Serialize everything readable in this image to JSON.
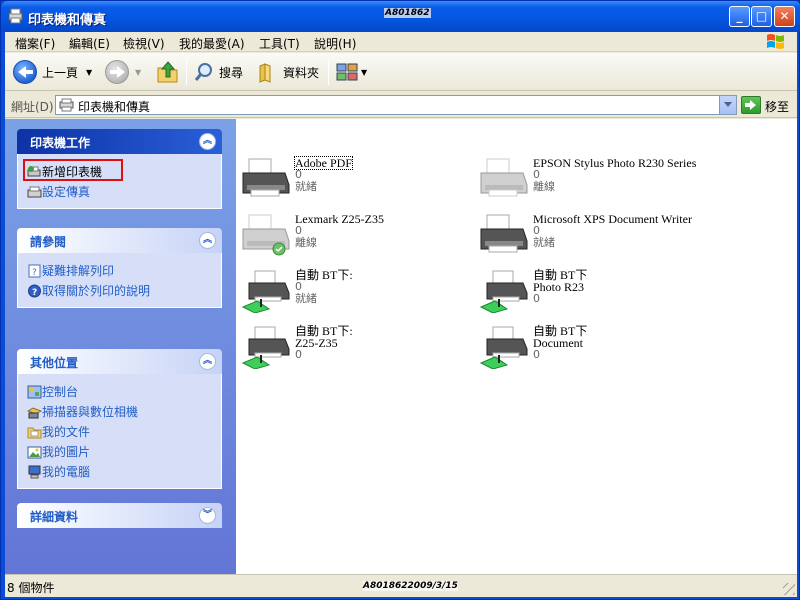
{
  "window": {
    "title": "印表機和傳真",
    "watermark": "A801862",
    "buttons": {
      "minimize": "_",
      "maximize": "□",
      "close": "✕"
    }
  },
  "menu": {
    "items": [
      "檔案(F)",
      "編輯(E)",
      "檢視(V)",
      "我的最愛(A)",
      "工具(T)",
      "說明(H)"
    ]
  },
  "toolbar": {
    "back_label": "上一頁",
    "search_label": "搜尋",
    "folders_label": "資料夾"
  },
  "address": {
    "label": "網址(D)",
    "value": "印表機和傳真",
    "go_label": "移至"
  },
  "panels": {
    "printer_tasks": {
      "title": "印表機工作",
      "items": [
        "新增印表機",
        "設定傳真"
      ]
    },
    "see_also": {
      "title": "請參閱",
      "items": [
        "疑難排解列印",
        "取得關於列印的說明"
      ]
    },
    "other_places": {
      "title": "其他位置",
      "items": [
        "控制台",
        "掃描器與數位相機",
        "我的文件",
        "我的圖片",
        "我的電腦"
      ]
    },
    "details": {
      "title": "詳細資料"
    }
  },
  "printers": [
    {
      "name": "Adobe PDF",
      "count": "0",
      "status": "就緒"
    },
    {
      "name": "EPSON Stylus Photo R230 Series",
      "count": "0",
      "status": "離線"
    },
    {
      "name": "Lexmark Z25-Z35",
      "count": "0",
      "status": "離線"
    },
    {
      "name": "Microsoft XPS Document Writer",
      "count": "0",
      "status": "就緒"
    },
    {
      "name": "自動 BT下:",
      "count": "0",
      "status": "就緒"
    },
    {
      "name": "自動 BT下",
      "name2": "Photo R23",
      "count": "0"
    },
    {
      "name": "自動 BT下:",
      "name2": "Z25-Z35",
      "count": "0"
    },
    {
      "name": "自動 BT下",
      "name2": "Document",
      "count": "0"
    }
  ],
  "status": {
    "count_text": "8 個物件",
    "watermark": "A8018622009/3/15"
  },
  "colors": {
    "title_blue": "#0a5ce8",
    "link_blue": "#215dc6",
    "pane_blue": "#6375d6",
    "highlight_red": "#e01010"
  }
}
